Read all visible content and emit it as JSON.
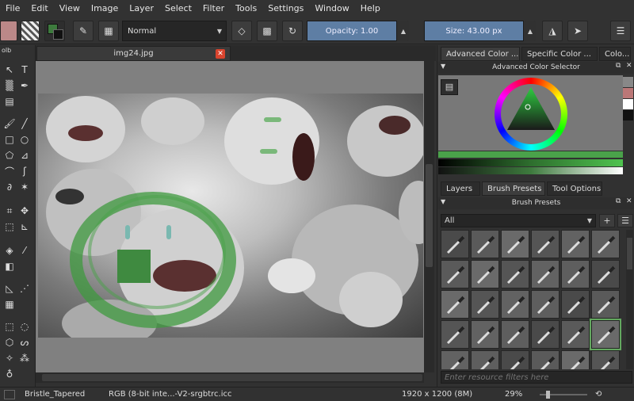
{
  "menu": [
    "File",
    "Edit",
    "View",
    "Image",
    "Layer",
    "Select",
    "Filter",
    "Tools",
    "Settings",
    "Window",
    "Help"
  ],
  "toolbar": {
    "blend_mode": "Normal",
    "opacity_label": "Opacity:",
    "opacity_value": "1.00",
    "size_label": "Size:",
    "size_value": "43.00 px"
  },
  "document": {
    "tab_title": "img24.jpg",
    "dock_label": "olb"
  },
  "right_dock": {
    "color_tabs": [
      "Advanced Color ...",
      "Specific Color ...",
      "Colo..."
    ],
    "color_panel_title": "Advanced Color Selector",
    "layer_tabs": [
      "Layers",
      "Brush Presets",
      "Tool Options"
    ],
    "brush_panel_title": "Brush Presets",
    "brush_filter": "All",
    "resource_filter_placeholder": "Enter resource filters here"
  },
  "status": {
    "brush_name": "Bristle_Tapered",
    "color_profile": "RGB (8-bit inte...-V2-srgbtrc.icc",
    "dimensions": "1920 x 1200 (8M)",
    "zoom": "29%"
  },
  "colors": {
    "foreground": "#3d7a3d",
    "accent": "#5e7ea4",
    "selected": "#63a85f"
  }
}
